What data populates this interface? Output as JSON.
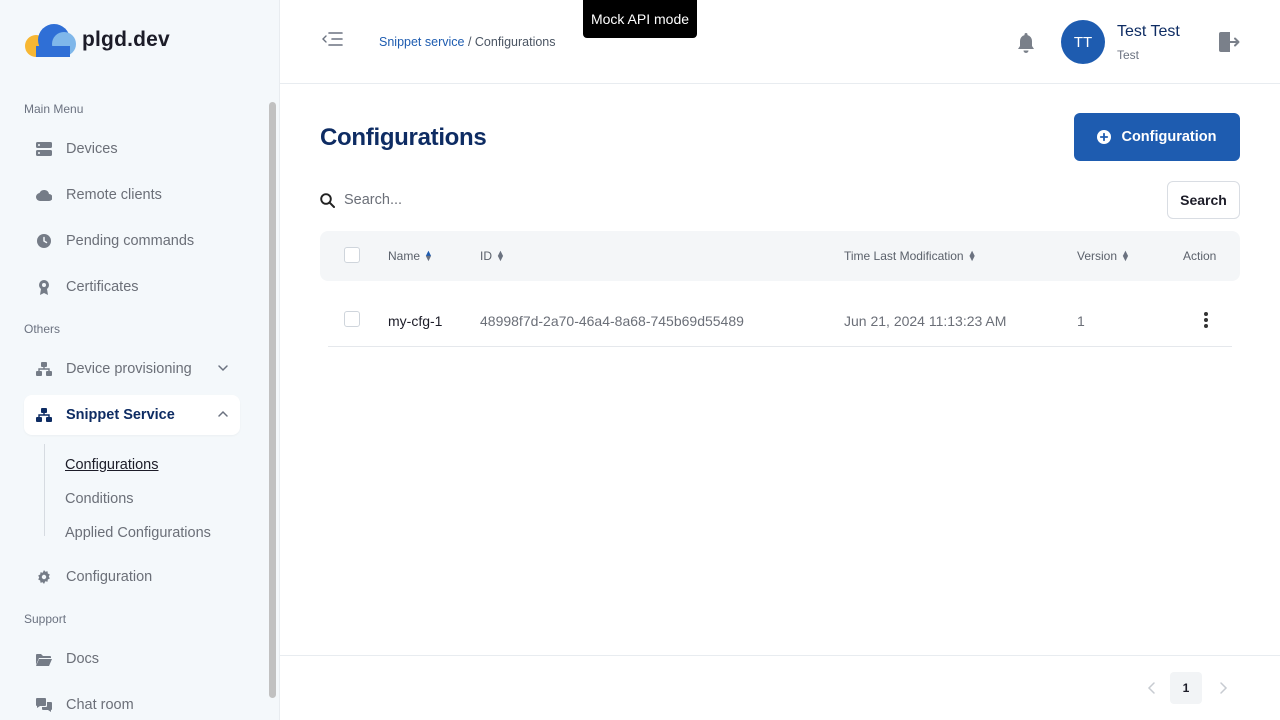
{
  "brand": {
    "name": "plgd.dev",
    "colors": {
      "primary": "#1e5cb0",
      "navy": "#0e2c63",
      "logo_yellow": "#f7b733",
      "logo_blue": "#2f80ed",
      "logo_light": "#7fb7ea"
    }
  },
  "sidebar": {
    "main_menu_label": "Main Menu",
    "others_label": "Others",
    "support_label": "Support",
    "items": [
      {
        "label": "Devices",
        "icon": "server-icon"
      },
      {
        "label": "Remote clients",
        "icon": "cloud-icon"
      },
      {
        "label": "Pending commands",
        "icon": "clock-icon"
      },
      {
        "label": "Certificates",
        "icon": "certificate-icon"
      },
      {
        "label": "Device provisioning",
        "icon": "network-icon",
        "expanded": false
      },
      {
        "label": "Snippet Service",
        "icon": "network-icon",
        "expanded": true,
        "active": true
      },
      {
        "label": "Configuration",
        "icon": "gear-icon"
      },
      {
        "label": "Docs",
        "icon": "folder-icon"
      },
      {
        "label": "Chat room",
        "icon": "chat-icon"
      }
    ],
    "snippet_sub": [
      {
        "label": "Configurations",
        "active": true
      },
      {
        "label": "Conditions"
      },
      {
        "label": "Applied Configurations"
      }
    ]
  },
  "header": {
    "breadcrumb_link": "Snippet service",
    "breadcrumb_sep": " / ",
    "breadcrumb_current": "Configurations",
    "mock_badge": "Mock API mode",
    "user": {
      "initials": "TT",
      "name": "Test Test",
      "role": "Test"
    }
  },
  "main": {
    "title": "Configurations",
    "add_button": "Configuration",
    "search_placeholder": "Search...",
    "search_button": "Search",
    "columns": [
      "Name",
      "ID",
      "Time Last Modification",
      "Version",
      "Action"
    ],
    "rows": [
      {
        "name": "my-cfg-1",
        "id": "48998f7d-2a70-46a4-8a68-745b69d55489",
        "modified": "Jun 21, 2024 11:13:23 AM",
        "version": "1"
      }
    ],
    "pagination": {
      "current": "1"
    }
  }
}
